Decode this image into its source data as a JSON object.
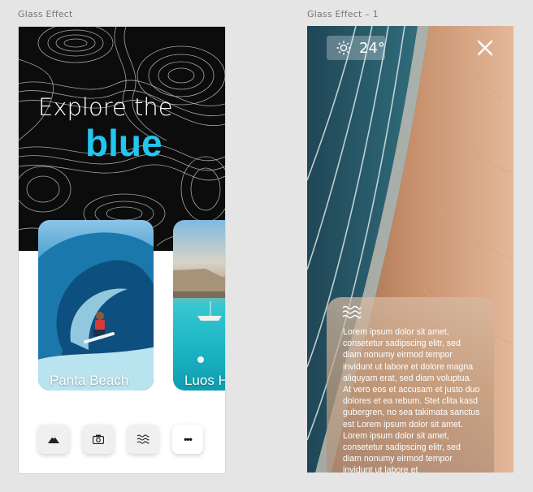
{
  "artboards": [
    {
      "label": "Glass  Effect"
    },
    {
      "label": "Glass  Effect – 1"
    }
  ],
  "explore": {
    "heading_line1": "Explore the",
    "heading_line2": "blue",
    "accent_color": "#22c7f0",
    "cards": [
      {
        "label": "Panta Beach",
        "image": "surfer-wave"
      },
      {
        "label": "Luos H",
        "image": "turquoise-bay"
      }
    ],
    "bottom_bar": [
      {
        "icon": "mountain-icon"
      },
      {
        "icon": "camera-icon"
      },
      {
        "icon": "waves-icon"
      },
      {
        "icon": "more-icon",
        "label": "•••"
      }
    ]
  },
  "detail": {
    "weather": {
      "icon": "sun-icon",
      "temperature": "24°"
    },
    "close_icon": "close-icon",
    "glass_card": {
      "icon": "waves-icon",
      "text": "Lorem ipsum dolor sit amet, consetetur sadipscing elitr, sed diam nonumy eirmod tempor invidunt ut labore et dolore magna aliquyam erat, sed diam voluptua. At vero eos et accusam et justo duo dolores et ea rebum. Stet clita kasd gubergren, no sea takimata sanctus est Lorem ipsum dolor sit amet. Lorem ipsum dolor sit amet, consetetur sadipscing elitr, sed diam nonumy eirmod tempor invidunt ut labore et"
    }
  }
}
